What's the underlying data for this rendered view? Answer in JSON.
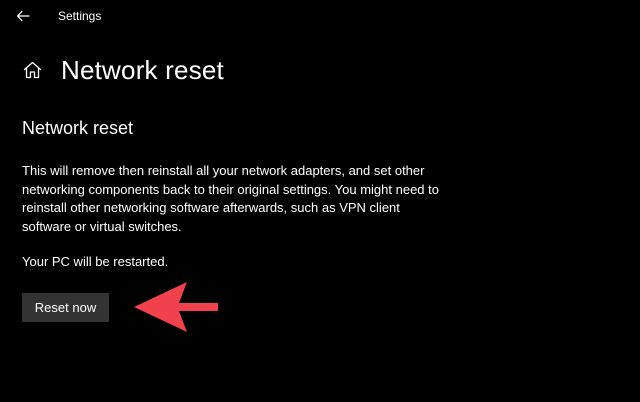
{
  "window": {
    "app_title": "Settings",
    "back_icon": "arrow-left-icon"
  },
  "header": {
    "icon": "home-icon",
    "title": "Network reset"
  },
  "section": {
    "title": "Network reset",
    "description": "This will remove then reinstall all your network adapters, and set other networking components back to their original settings. You might need to reinstall other networking software afterwards, such as VPN client software or virtual switches.",
    "restart_note": "Your PC will be restarted.",
    "reset_button_label": "Reset now"
  },
  "annotation": {
    "type": "arrow",
    "color": "#f0414c",
    "points_to": "reset-now-button"
  },
  "colors": {
    "background": "#000000",
    "text": "#ffffff",
    "button": "#333333"
  }
}
